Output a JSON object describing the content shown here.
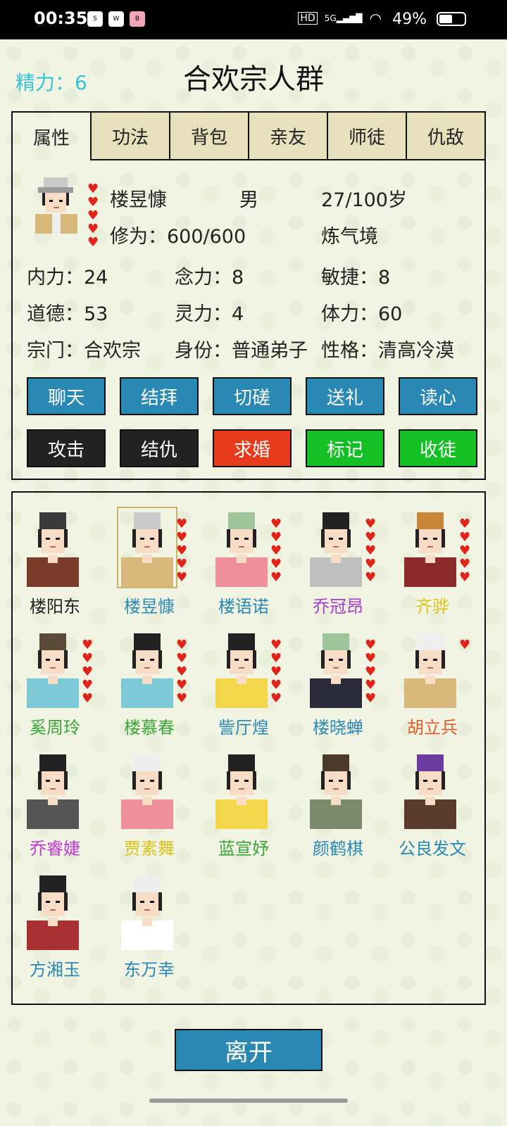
{
  "status": {
    "time": "00:35",
    "battery": "49%",
    "network": "5G",
    "hd": "HD",
    "apps": [
      "soul",
      "wechat",
      "weibo"
    ]
  },
  "header": {
    "energy_label": "精力：6",
    "title": "合欢宗人群"
  },
  "tabs": [
    "属性",
    "功法",
    "背包",
    "亲友",
    "师徒",
    "仇敌"
  ],
  "profile": {
    "name": "楼昱慷",
    "gender": "男",
    "age": "27/100岁",
    "cultivation": "修为：600/600",
    "realm": "炼气境",
    "hearts": 5,
    "stats": {
      "neili": "内力：24",
      "nianli": "念力：8",
      "minjie": "敏捷：8",
      "daode": "道德：53",
      "lingli": "灵力：4",
      "tili": "体力：60",
      "sect": "宗门：合欢宗",
      "identity": "身份：普通弟子",
      "personality": "性格：清高冷漠"
    }
  },
  "actions_row1": [
    {
      "label": "聊天",
      "color": "#2a88b4"
    },
    {
      "label": "结拜",
      "color": "#2a88b4"
    },
    {
      "label": "切磋",
      "color": "#2a88b4"
    },
    {
      "label": "送礼",
      "color": "#2a88b4"
    },
    {
      "label": "读心",
      "color": "#2a88b4"
    }
  ],
  "actions_row2": [
    {
      "label": "攻击",
      "color": "#222222"
    },
    {
      "label": "结仇",
      "color": "#222222"
    },
    {
      "label": "求婚",
      "color": "#e83a1c"
    },
    {
      "label": "标记",
      "color": "#14c023"
    },
    {
      "label": "收徒",
      "color": "#14c023"
    }
  ],
  "members": [
    {
      "name": "楼阳东",
      "color": "#222222",
      "hearts": 0
    },
    {
      "name": "楼昱慷",
      "color": "#2a88b4",
      "hearts": 5
    },
    {
      "name": "楼语诺",
      "color": "#2a88b4",
      "hearts": 5
    },
    {
      "name": "乔冠昂",
      "color": "#a53cc8",
      "hearts": 5
    },
    {
      "name": "齐骅",
      "color": "#d9c21b",
      "hearts": 5
    },
    {
      "name": "奚周玲",
      "color": "#3aa63a",
      "hearts": 5
    },
    {
      "name": "楼慕春",
      "color": "#3aa63a",
      "hearts": 5
    },
    {
      "name": "訾厅煌",
      "color": "#2a88b4",
      "hearts": 5
    },
    {
      "name": "楼晓蝉",
      "color": "#2a88b4",
      "hearts": 5
    },
    {
      "name": "胡立兵",
      "color": "#e05a2a",
      "hearts": 1
    },
    {
      "name": "乔睿婕",
      "color": "#c03ad0",
      "hearts": 0
    },
    {
      "name": "贾素舞",
      "color": "#d9c21b",
      "hearts": 0
    },
    {
      "name": "蓝宣妤",
      "color": "#3aa63a",
      "hearts": 0
    },
    {
      "name": "颜鹤棋",
      "color": "#2a88b4",
      "hearts": 0
    },
    {
      "name": "公良发文",
      "color": "#2a88b4",
      "hearts": 0
    },
    {
      "name": "方湘玉",
      "color": "#2a88b4",
      "hearts": 0
    },
    {
      "name": "东万幸",
      "color": "#2a88b4",
      "hearts": 0
    }
  ],
  "leave_label": "离开"
}
